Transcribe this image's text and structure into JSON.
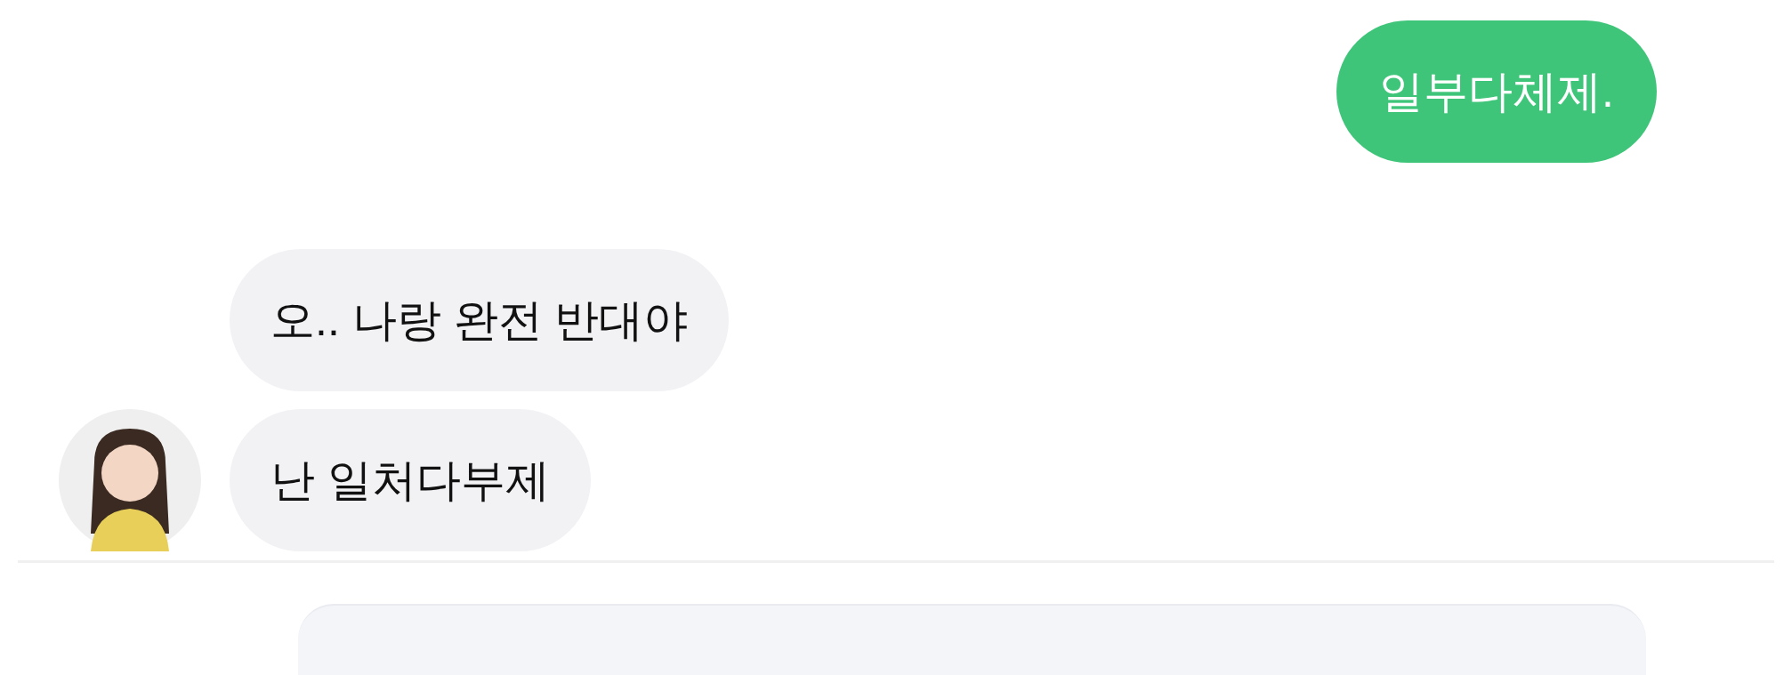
{
  "messages": [
    {
      "kind": "sent",
      "text": "일부다체제."
    },
    {
      "kind": "received",
      "text": "오.. 나랑 완전 반대야"
    },
    {
      "kind": "received",
      "text": "난 일처다부제",
      "avatar": true
    }
  ],
  "input": {
    "kind": "field"
  }
}
